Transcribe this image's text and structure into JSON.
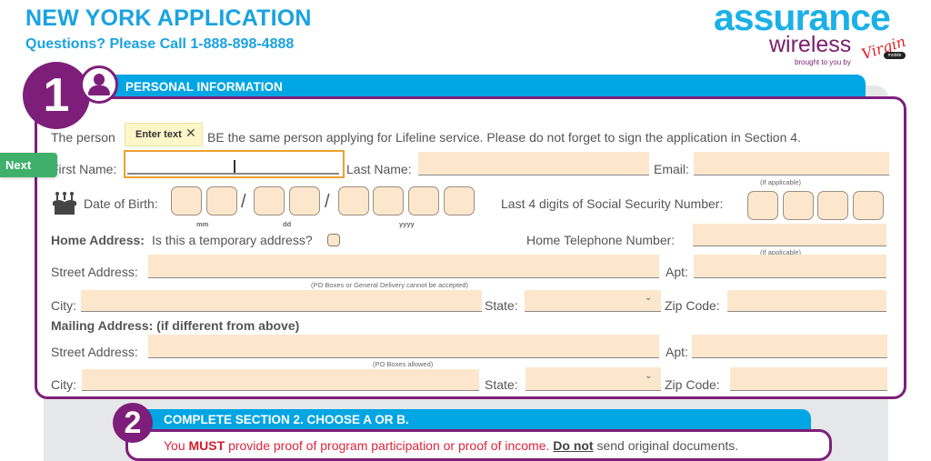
{
  "header": {
    "title": "NEW YORK APPLICATION",
    "phone_line": "Questions? Please Call 1-888-898-4888"
  },
  "logo": {
    "brand": "assurance",
    "sub": "wireless",
    "brought_by": "brought to you by",
    "partner": "Virgin",
    "partner_sub": "mobile"
  },
  "colors": {
    "accent_blue": "#00a5e3",
    "accent_purple": "#7d1f7a",
    "field_fill": "#fde7cc",
    "focus_border": "#f0a030",
    "next_button": "#3fb06b",
    "warning_red": "#e0243a"
  },
  "overlay": {
    "next_label": "Next",
    "tooltip_label": "Enter text",
    "tooltip_close": "✕"
  },
  "section1": {
    "number": "1",
    "icon": "person-icon",
    "title": "PERSONAL INFORMATION",
    "intro_before": "The person",
    "intro_after": "BE the same person applying for Lifeline service. Please do not forget to sign the application in Section 4.",
    "first_name_label": "First Name:",
    "first_name_value": "",
    "last_name_label": "Last Name:",
    "last_name_value": "",
    "email_label": "Email:",
    "email_value": "",
    "email_note": "(If applicable)",
    "dob_label": "Date of Birth:",
    "dob_icon": "birthday-cake-icon",
    "dob_sep": "/",
    "dob_mm": "mm",
    "dob_dd": "dd",
    "dob_yyyy": "yyyy",
    "ssn_label": "Last 4 digits of Social Security Number:",
    "home_address_label": "Home Address:",
    "temp_address_question": "Is this a temporary address?",
    "temp_address_checked": false,
    "home_phone_label": "Home Telephone Number:",
    "home_phone_note": "(If applicable)",
    "street_label": "Street Address:",
    "street_note": "(PO Boxes or General Delivery cannot be accepted)",
    "apt_label": "Apt:",
    "city_label": "City:",
    "state_label": "State:",
    "state_value": "",
    "zip_label": "Zip Code:",
    "mailing_label": "Mailing Address: (if different from above)",
    "mailing_street_label": "Street Address:",
    "mailing_street_note": "(PO Boxes allowed)",
    "mailing_apt_label": "Apt:",
    "mailing_city_label": "City:",
    "mailing_state_label": "State:",
    "mailing_state_value": "",
    "mailing_zip_label": "Zip Code:"
  },
  "section2": {
    "number": "2",
    "title": "COMPLETE SECTION 2. CHOOSE A OR B.",
    "text_you": "You ",
    "text_must": "MUST",
    "text_middle": " provide proof of program participation or proof of income. ",
    "text_donot": "Do not",
    "text_end": " send original documents."
  }
}
